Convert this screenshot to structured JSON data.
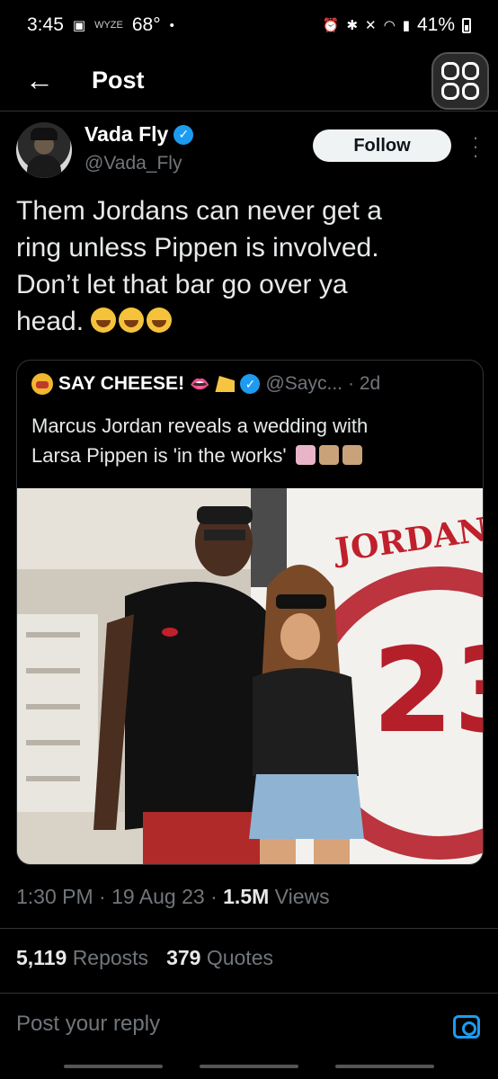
{
  "status_bar": {
    "time": "3:45",
    "wyze_label": "WYZE",
    "temperature": "68°",
    "battery": "41%"
  },
  "header": {
    "back_icon": "arrow-left-icon",
    "title": "Post",
    "grok_icon": "grok-icon"
  },
  "post": {
    "author_name": "Vada Fly",
    "author_handle": "@Vada_Fly",
    "follow_label": "Follow",
    "text_lines": [
      "Them Jordans can never get a",
      "ring unless Pippen is involved.",
      "Don’t let that bar go over ya",
      "head."
    ],
    "quote": {
      "name": "SAY CHEESE!",
      "handle": "@Sayc...",
      "time": "· 2d",
      "text_line1": "Marcus Jordan reveals a wedding with",
      "text_line2": "Larsa Pippen is 'in the works'"
    },
    "timestamp": "1:30 PM · 19 Aug 23 ·",
    "views_count": "1.5M",
    "views_label": "Views",
    "reposts_count": "5,119",
    "reposts_label": "Reposts",
    "quotes_count": "379",
    "quotes_label": "Quotes"
  },
  "reply": {
    "placeholder": "Post your reply"
  },
  "colors": {
    "background": "#000000",
    "accent": "#1d9bf0",
    "text": "#e7e9ea",
    "secondary": "#71767b"
  }
}
